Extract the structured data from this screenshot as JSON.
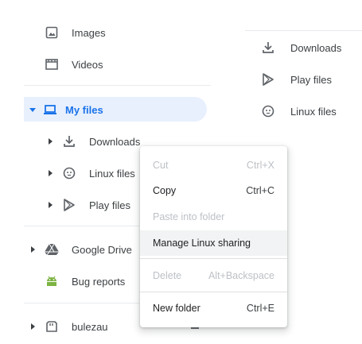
{
  "sidebar": {
    "items": [
      {
        "label": "Images",
        "icon": "image-icon"
      },
      {
        "label": "Videos",
        "icon": "video-icon"
      },
      {
        "label": "My files",
        "icon": "laptop-icon"
      },
      {
        "label": "Downloads",
        "icon": "download-icon"
      },
      {
        "label": "Linux files",
        "icon": "linux-icon"
      },
      {
        "label": "Play files",
        "icon": "play-store-icon"
      },
      {
        "label": "Google Drive",
        "icon": "drive-icon"
      },
      {
        "label": "Bug reports",
        "icon": "android-icon"
      },
      {
        "label": "bulezau",
        "icon": "usb-drive-icon"
      }
    ]
  },
  "content": {
    "items": [
      {
        "label": "Downloads",
        "icon": "download-icon"
      },
      {
        "label": "Play files",
        "icon": "play-store-icon"
      },
      {
        "label": "Linux files",
        "icon": "linux-icon"
      }
    ]
  },
  "context_menu": {
    "items": [
      {
        "label": "Cut",
        "shortcut": "Ctrl+X",
        "disabled": true
      },
      {
        "label": "Copy",
        "shortcut": "Ctrl+C",
        "disabled": false
      },
      {
        "label": "Paste into folder",
        "shortcut": "",
        "disabled": true
      },
      {
        "label": "Manage Linux sharing",
        "shortcut": "",
        "disabled": false
      },
      {
        "label": "Delete",
        "shortcut": "Alt+Backspace",
        "disabled": true
      },
      {
        "label": "New folder",
        "shortcut": "Ctrl+E",
        "disabled": false
      }
    ]
  },
  "colors": {
    "accent": "#1a73e8",
    "selected_bg": "#e8f0fe",
    "icon_gray": "#5f6368",
    "android_green": "#7cb342"
  }
}
